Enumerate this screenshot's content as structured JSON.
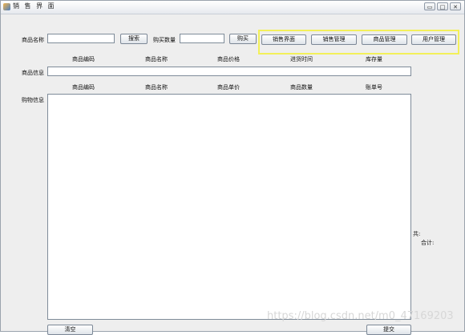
{
  "window": {
    "title": "销 售 界 面",
    "controls": [
      "▭",
      "□",
      "✕"
    ]
  },
  "search": {
    "product_name_label": "商品名称",
    "product_name_value": "",
    "search_button": "搜索",
    "quantity_label": "购买数量",
    "quantity_value": "",
    "buy_button": "购买"
  },
  "nav": {
    "items": [
      "销售界面",
      "销售管理",
      "商品管理",
      "用户管理"
    ],
    "highlight_color": "#f3f05a"
  },
  "product_table": {
    "headers": [
      "商品编码",
      "商品名称",
      "商品价格",
      "进货时间",
      "库存量"
    ],
    "row_label": "商品信息",
    "row_value": ""
  },
  "cart_table": {
    "headers": [
      "商品编码",
      "商品名称",
      "商品单价",
      "商品数量",
      "账单号"
    ],
    "row_label": "购物信息"
  },
  "summary": {
    "total_items_label": "共:",
    "total_amount_label": "合计:"
  },
  "footer": {
    "clear_button": "清空",
    "submit_button": "提交"
  },
  "watermark": "https://blog.csdn.net/m0_47169203"
}
